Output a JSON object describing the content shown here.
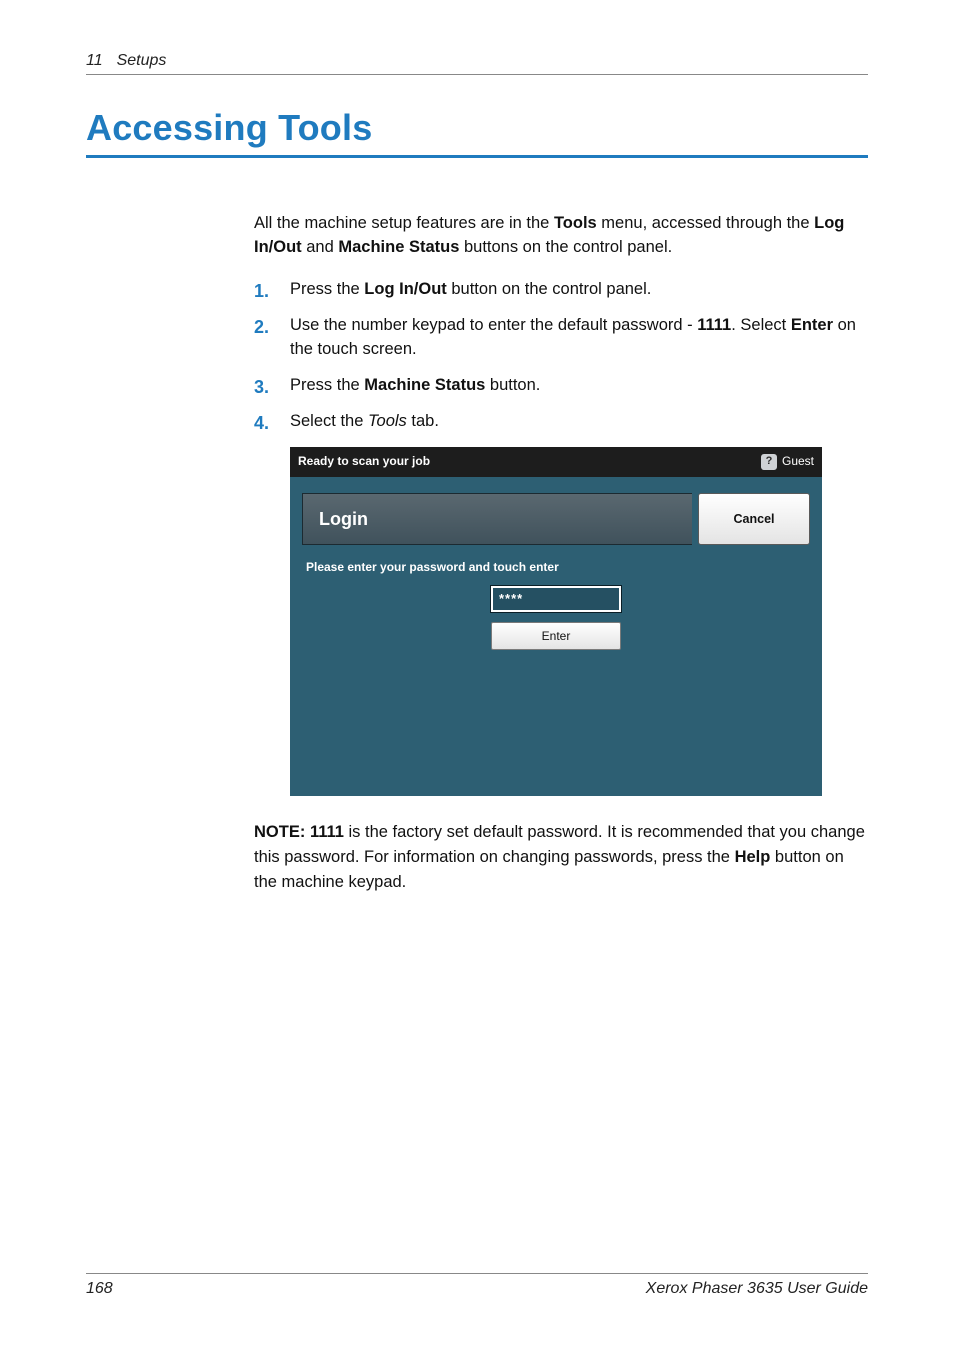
{
  "header": {
    "chapter_number": "11",
    "chapter_title": "Setups"
  },
  "title": "Accessing Tools",
  "intro": {
    "p1a": "All the machine setup features are in the ",
    "p1b": "Tools",
    "p1c": " menu, accessed through the ",
    "p1d": "Log In/Out",
    "p1e": " and ",
    "p1f": "Machine Status",
    "p1g": " buttons on the control panel."
  },
  "steps": {
    "s1a": "Press the ",
    "s1b": "Log In/Out",
    "s1c": " button on the control panel.",
    "s2a": "Use the number keypad to enter the default password - ",
    "s2b": "1111",
    "s2c": ". Select ",
    "s2d": "Enter",
    "s2e": " on the touch screen.",
    "s3a": "Press the ",
    "s3b": "Machine Status",
    "s3c": " button.",
    "s4a": "Select the ",
    "s4b": "Tools",
    "s4c": " tab."
  },
  "screenshot": {
    "status": "Ready to scan your job",
    "guest_label": "Guest",
    "guest_q": "?",
    "login_title": "Login",
    "cancel": "Cancel",
    "prompt": "Please enter your password and touch enter",
    "password_value": "****",
    "enter": "Enter"
  },
  "note": {
    "label": "NOTE:",
    "a": " ",
    "b": "1111",
    "c": " is the factory set default password. It is recommended that you change this password. For information on changing passwords, press the ",
    "d": "Help",
    "e": " button on the machine keypad."
  },
  "footer": {
    "page": "168",
    "doc": "Xerox Phaser 3635 User Guide"
  }
}
